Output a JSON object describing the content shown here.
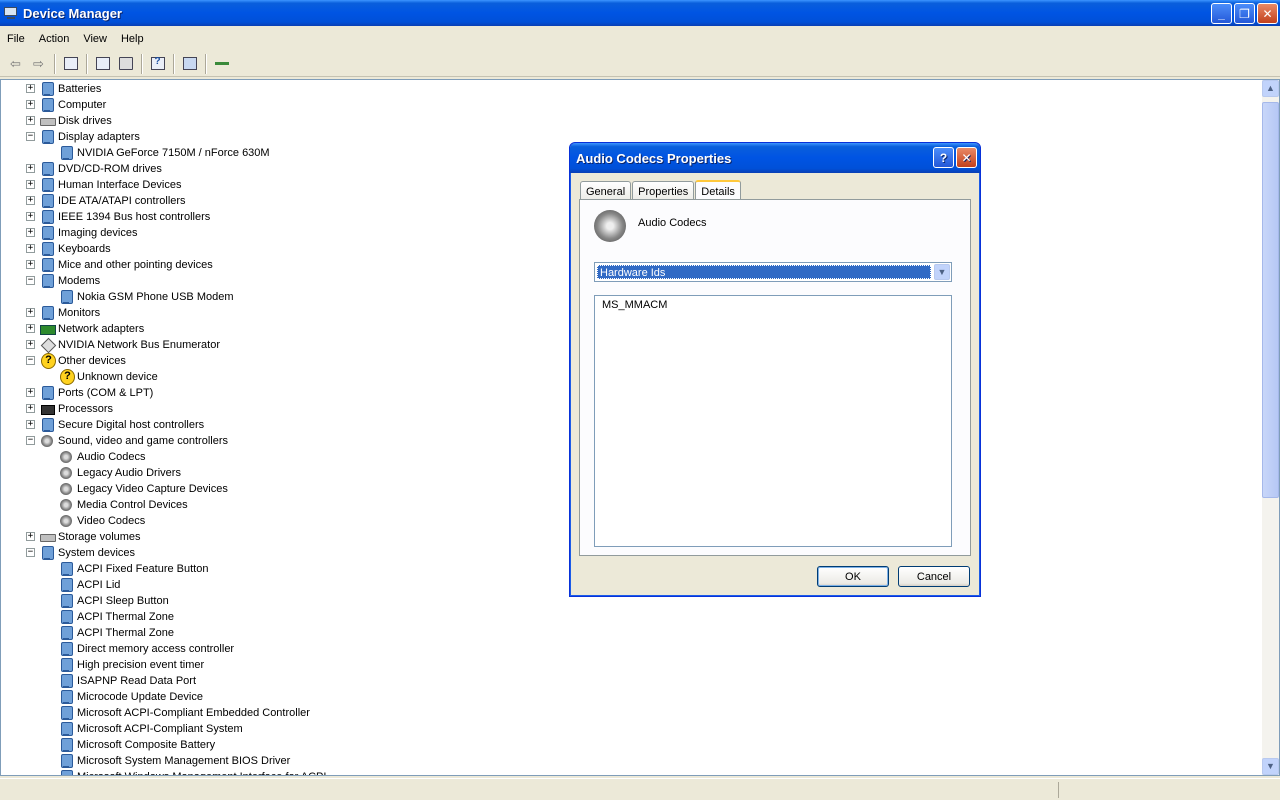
{
  "window": {
    "title": "Device Manager"
  },
  "menu": [
    "File",
    "Action",
    "View",
    "Help"
  ],
  "tree": [
    {
      "label": "Batteries",
      "depth": 0,
      "expander": "+",
      "icon": "battery-icon"
    },
    {
      "label": "Computer",
      "depth": 0,
      "expander": "+",
      "icon": "computer-icon"
    },
    {
      "label": "Disk drives",
      "depth": 0,
      "expander": "+",
      "icon": "disk-drive-icon"
    },
    {
      "label": "Display adapters",
      "depth": 0,
      "expander": "-",
      "icon": "display-adapter-icon"
    },
    {
      "label": "NVIDIA GeForce 7150M / nForce 630M",
      "depth": 1,
      "icon": "display-adapter-icon"
    },
    {
      "label": "DVD/CD-ROM drives",
      "depth": 0,
      "expander": "+",
      "icon": "cdrom-icon"
    },
    {
      "label": "Human Interface Devices",
      "depth": 0,
      "expander": "+",
      "icon": "hid-icon"
    },
    {
      "label": "IDE ATA/ATAPI controllers",
      "depth": 0,
      "expander": "+",
      "icon": "ide-controller-icon"
    },
    {
      "label": "IEEE 1394 Bus host controllers",
      "depth": 0,
      "expander": "+",
      "icon": "ieee1394-icon"
    },
    {
      "label": "Imaging devices",
      "depth": 0,
      "expander": "+",
      "icon": "imaging-icon"
    },
    {
      "label": "Keyboards",
      "depth": 0,
      "expander": "+",
      "icon": "keyboard-icon"
    },
    {
      "label": "Mice and other pointing devices",
      "depth": 0,
      "expander": "+",
      "icon": "mouse-icon"
    },
    {
      "label": "Modems",
      "depth": 0,
      "expander": "-",
      "icon": "modem-icon"
    },
    {
      "label": "Nokia GSM Phone USB Modem",
      "depth": 1,
      "icon": "modem-icon"
    },
    {
      "label": "Monitors",
      "depth": 0,
      "expander": "+",
      "icon": "monitor-icon"
    },
    {
      "label": "Network adapters",
      "depth": 0,
      "expander": "+",
      "icon": "network-adapter-icon"
    },
    {
      "label": "NVIDIA Network Bus Enumerator",
      "depth": 0,
      "expander": "+",
      "icon": "bus-enumerator-icon"
    },
    {
      "label": "Other devices",
      "depth": 0,
      "expander": "-",
      "icon": "unknown-device-icon"
    },
    {
      "label": "Unknown device",
      "depth": 1,
      "icon": "unknown-device-icon"
    },
    {
      "label": "Ports (COM & LPT)",
      "depth": 0,
      "expander": "+",
      "icon": "port-icon"
    },
    {
      "label": "Processors",
      "depth": 0,
      "expander": "+",
      "icon": "processor-icon"
    },
    {
      "label": "Secure Digital host controllers",
      "depth": 0,
      "expander": "+",
      "icon": "sd-controller-icon"
    },
    {
      "label": "Sound, video and game controllers",
      "depth": 0,
      "expander": "-",
      "icon": "speaker-icon"
    },
    {
      "label": "Audio Codecs",
      "depth": 1,
      "icon": "speaker-icon"
    },
    {
      "label": "Legacy Audio Drivers",
      "depth": 1,
      "icon": "speaker-icon"
    },
    {
      "label": "Legacy Video Capture Devices",
      "depth": 1,
      "icon": "speaker-icon"
    },
    {
      "label": "Media Control Devices",
      "depth": 1,
      "icon": "speaker-icon"
    },
    {
      "label": "Video Codecs",
      "depth": 1,
      "icon": "speaker-icon"
    },
    {
      "label": "Storage volumes",
      "depth": 0,
      "expander": "+",
      "icon": "storage-volume-icon"
    },
    {
      "label": "System devices",
      "depth": 0,
      "expander": "-",
      "icon": "system-device-icon"
    },
    {
      "label": "ACPI Fixed Feature Button",
      "depth": 1,
      "icon": "system-device-icon"
    },
    {
      "label": "ACPI Lid",
      "depth": 1,
      "icon": "system-device-icon"
    },
    {
      "label": "ACPI Sleep Button",
      "depth": 1,
      "icon": "system-device-icon"
    },
    {
      "label": "ACPI Thermal Zone",
      "depth": 1,
      "icon": "system-device-icon"
    },
    {
      "label": "ACPI Thermal Zone",
      "depth": 1,
      "icon": "system-device-icon"
    },
    {
      "label": "Direct memory access controller",
      "depth": 1,
      "icon": "system-device-icon"
    },
    {
      "label": "High precision event timer",
      "depth": 1,
      "icon": "system-device-icon"
    },
    {
      "label": "ISAPNP Read Data Port",
      "depth": 1,
      "icon": "system-device-icon"
    },
    {
      "label": "Microcode Update Device",
      "depth": 1,
      "icon": "system-device-icon"
    },
    {
      "label": "Microsoft ACPI-Compliant Embedded Controller",
      "depth": 1,
      "icon": "system-device-icon"
    },
    {
      "label": "Microsoft ACPI-Compliant System",
      "depth": 1,
      "icon": "system-device-icon"
    },
    {
      "label": "Microsoft Composite Battery",
      "depth": 1,
      "icon": "system-device-icon"
    },
    {
      "label": "Microsoft System Management BIOS Driver",
      "depth": 1,
      "icon": "system-device-icon"
    },
    {
      "label": "Microsoft Windows Management Interface for ACPI",
      "depth": 1,
      "icon": "system-device-icon"
    }
  ],
  "dialog": {
    "title": "Audio Codecs Properties",
    "help_glyph": "?",
    "close_glyph": "✕",
    "tabs": [
      "General",
      "Properties",
      "Details"
    ],
    "active_tab": "Details",
    "device_name": "Audio Codecs",
    "property_selected": "Hardware Ids",
    "values": [
      "MS_MMACM"
    ],
    "ok_label": "OK",
    "cancel_label": "Cancel"
  },
  "colors": {
    "title_blue": "#0054e3",
    "selection": "#316ac5",
    "close_red": "#c2401d"
  }
}
